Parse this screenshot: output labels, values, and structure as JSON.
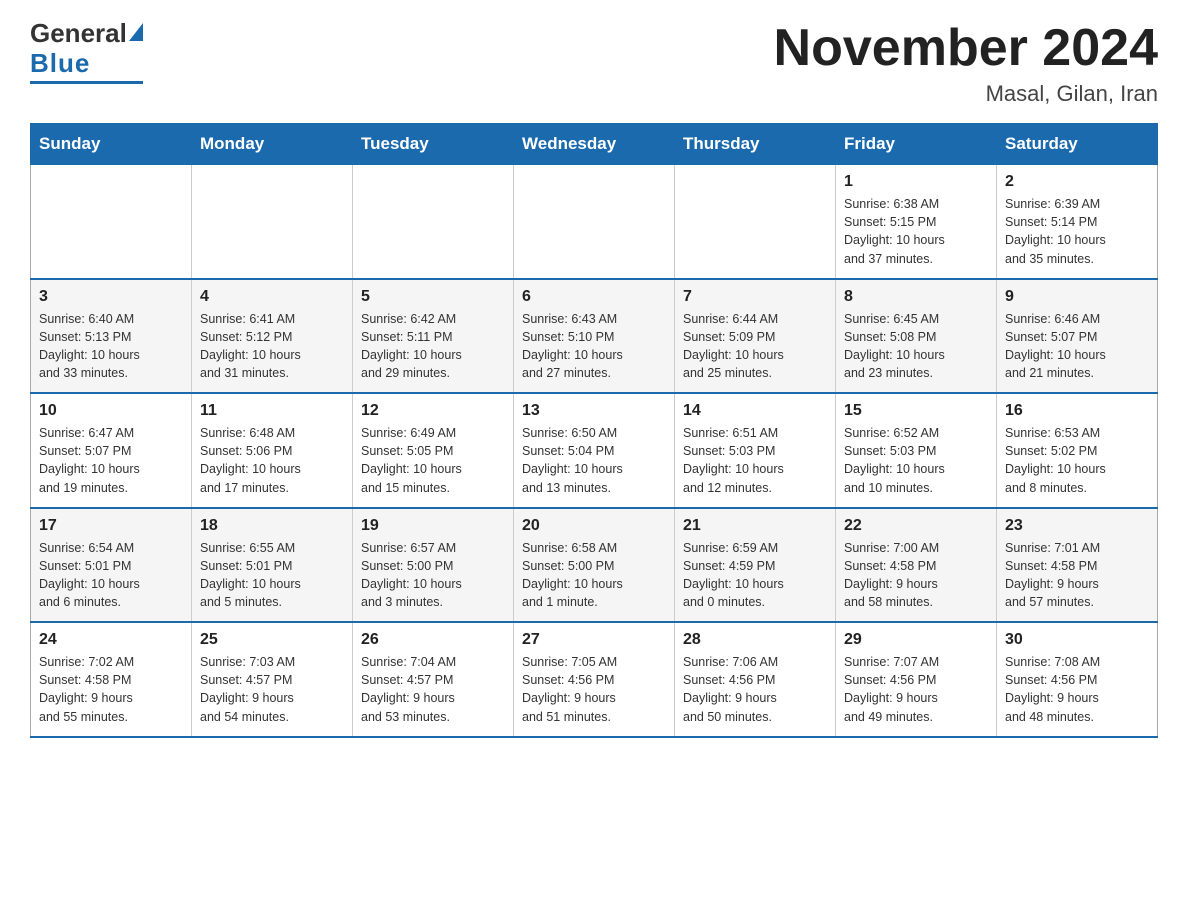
{
  "header": {
    "logo_general": "General",
    "logo_blue": "Blue",
    "month_title": "November 2024",
    "location": "Masal, Gilan, Iran"
  },
  "days_of_week": [
    "Sunday",
    "Monday",
    "Tuesday",
    "Wednesday",
    "Thursday",
    "Friday",
    "Saturday"
  ],
  "weeks": [
    {
      "days": [
        {
          "number": "",
          "info": ""
        },
        {
          "number": "",
          "info": ""
        },
        {
          "number": "",
          "info": ""
        },
        {
          "number": "",
          "info": ""
        },
        {
          "number": "",
          "info": ""
        },
        {
          "number": "1",
          "info": "Sunrise: 6:38 AM\nSunset: 5:15 PM\nDaylight: 10 hours\nand 37 minutes."
        },
        {
          "number": "2",
          "info": "Sunrise: 6:39 AM\nSunset: 5:14 PM\nDaylight: 10 hours\nand 35 minutes."
        }
      ]
    },
    {
      "days": [
        {
          "number": "3",
          "info": "Sunrise: 6:40 AM\nSunset: 5:13 PM\nDaylight: 10 hours\nand 33 minutes."
        },
        {
          "number": "4",
          "info": "Sunrise: 6:41 AM\nSunset: 5:12 PM\nDaylight: 10 hours\nand 31 minutes."
        },
        {
          "number": "5",
          "info": "Sunrise: 6:42 AM\nSunset: 5:11 PM\nDaylight: 10 hours\nand 29 minutes."
        },
        {
          "number": "6",
          "info": "Sunrise: 6:43 AM\nSunset: 5:10 PM\nDaylight: 10 hours\nand 27 minutes."
        },
        {
          "number": "7",
          "info": "Sunrise: 6:44 AM\nSunset: 5:09 PM\nDaylight: 10 hours\nand 25 minutes."
        },
        {
          "number": "8",
          "info": "Sunrise: 6:45 AM\nSunset: 5:08 PM\nDaylight: 10 hours\nand 23 minutes."
        },
        {
          "number": "9",
          "info": "Sunrise: 6:46 AM\nSunset: 5:07 PM\nDaylight: 10 hours\nand 21 minutes."
        }
      ]
    },
    {
      "days": [
        {
          "number": "10",
          "info": "Sunrise: 6:47 AM\nSunset: 5:07 PM\nDaylight: 10 hours\nand 19 minutes."
        },
        {
          "number": "11",
          "info": "Sunrise: 6:48 AM\nSunset: 5:06 PM\nDaylight: 10 hours\nand 17 minutes."
        },
        {
          "number": "12",
          "info": "Sunrise: 6:49 AM\nSunset: 5:05 PM\nDaylight: 10 hours\nand 15 minutes."
        },
        {
          "number": "13",
          "info": "Sunrise: 6:50 AM\nSunset: 5:04 PM\nDaylight: 10 hours\nand 13 minutes."
        },
        {
          "number": "14",
          "info": "Sunrise: 6:51 AM\nSunset: 5:03 PM\nDaylight: 10 hours\nand 12 minutes."
        },
        {
          "number": "15",
          "info": "Sunrise: 6:52 AM\nSunset: 5:03 PM\nDaylight: 10 hours\nand 10 minutes."
        },
        {
          "number": "16",
          "info": "Sunrise: 6:53 AM\nSunset: 5:02 PM\nDaylight: 10 hours\nand 8 minutes."
        }
      ]
    },
    {
      "days": [
        {
          "number": "17",
          "info": "Sunrise: 6:54 AM\nSunset: 5:01 PM\nDaylight: 10 hours\nand 6 minutes."
        },
        {
          "number": "18",
          "info": "Sunrise: 6:55 AM\nSunset: 5:01 PM\nDaylight: 10 hours\nand 5 minutes."
        },
        {
          "number": "19",
          "info": "Sunrise: 6:57 AM\nSunset: 5:00 PM\nDaylight: 10 hours\nand 3 minutes."
        },
        {
          "number": "20",
          "info": "Sunrise: 6:58 AM\nSunset: 5:00 PM\nDaylight: 10 hours\nand 1 minute."
        },
        {
          "number": "21",
          "info": "Sunrise: 6:59 AM\nSunset: 4:59 PM\nDaylight: 10 hours\nand 0 minutes."
        },
        {
          "number": "22",
          "info": "Sunrise: 7:00 AM\nSunset: 4:58 PM\nDaylight: 9 hours\nand 58 minutes."
        },
        {
          "number": "23",
          "info": "Sunrise: 7:01 AM\nSunset: 4:58 PM\nDaylight: 9 hours\nand 57 minutes."
        }
      ]
    },
    {
      "days": [
        {
          "number": "24",
          "info": "Sunrise: 7:02 AM\nSunset: 4:58 PM\nDaylight: 9 hours\nand 55 minutes."
        },
        {
          "number": "25",
          "info": "Sunrise: 7:03 AM\nSunset: 4:57 PM\nDaylight: 9 hours\nand 54 minutes."
        },
        {
          "number": "26",
          "info": "Sunrise: 7:04 AM\nSunset: 4:57 PM\nDaylight: 9 hours\nand 53 minutes."
        },
        {
          "number": "27",
          "info": "Sunrise: 7:05 AM\nSunset: 4:56 PM\nDaylight: 9 hours\nand 51 minutes."
        },
        {
          "number": "28",
          "info": "Sunrise: 7:06 AM\nSunset: 4:56 PM\nDaylight: 9 hours\nand 50 minutes."
        },
        {
          "number": "29",
          "info": "Sunrise: 7:07 AM\nSunset: 4:56 PM\nDaylight: 9 hours\nand 49 minutes."
        },
        {
          "number": "30",
          "info": "Sunrise: 7:08 AM\nSunset: 4:56 PM\nDaylight: 9 hours\nand 48 minutes."
        }
      ]
    }
  ]
}
